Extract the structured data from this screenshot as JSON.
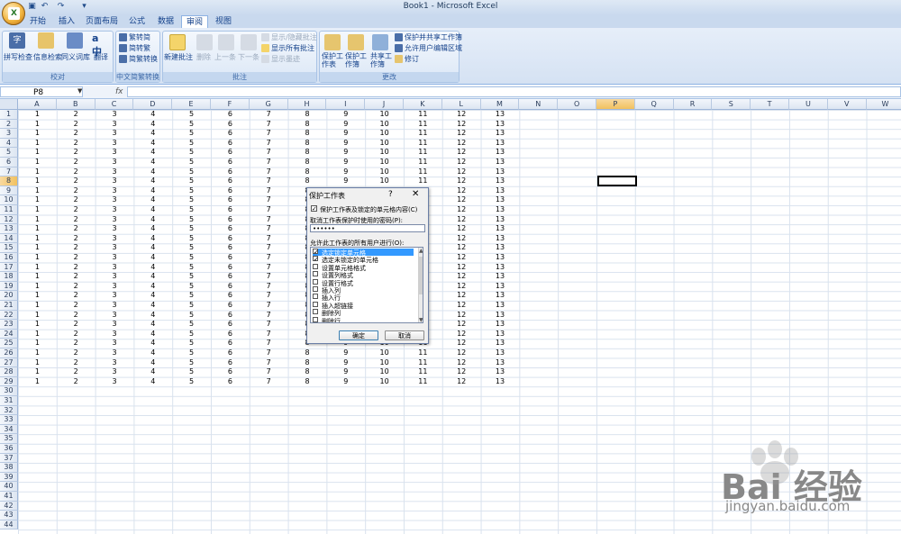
{
  "window": {
    "title": "Book1 - Microsoft Excel"
  },
  "tabs": [
    "开始",
    "插入",
    "页面布局",
    "公式",
    "数据",
    "审阅",
    "视图"
  ],
  "active_tab": "审阅",
  "ribbon": {
    "groups": [
      {
        "name": "校对",
        "buttons": [
          "拼写检查",
          "信息检索",
          "同义词库",
          "翻译"
        ]
      },
      {
        "name": "中文简繁转换",
        "buttons": [
          "繁转简",
          "简转繁",
          "简繁转换"
        ]
      },
      {
        "name": "批注",
        "buttons": [
          "新建批注",
          "删除",
          "上一条",
          "下一条"
        ],
        "small": [
          "显示/隐藏批注",
          "显示所有批注",
          "显示墨迹"
        ]
      },
      {
        "name": "更改",
        "buttons": [
          "保护工作表",
          "保护工作簿",
          "共享工作簿"
        ],
        "small": [
          "保护并共享工作簿",
          "允许用户编辑区域",
          "修订"
        ]
      }
    ]
  },
  "formula_bar": {
    "name_box": "P8",
    "fx": "fx",
    "value": ""
  },
  "grid": {
    "columns": [
      "A",
      "B",
      "C",
      "D",
      "E",
      "F",
      "G",
      "H",
      "I",
      "J",
      "K",
      "L",
      "M",
      "N",
      "O",
      "P",
      "Q",
      "R",
      "S",
      "T",
      "U",
      "V",
      "W"
    ],
    "selected_column": "P",
    "selected_row": 8,
    "row_values": [
      1,
      2,
      3,
      4,
      5,
      6,
      7,
      8,
      9,
      10,
      11,
      12,
      13
    ],
    "filled_rows": 29,
    "total_rows": 44
  },
  "dialog": {
    "title": "保护工作表",
    "help": "?",
    "close": "✕",
    "protect_label": "保护工作表及锁定的单元格内容(C)",
    "protect_checked": true,
    "password_label": "取消工作表保护时使用的密码(P):",
    "password_value": "••••••",
    "allow_label": "允许此工作表的所有用户进行(O):",
    "options": [
      {
        "label": "选定锁定单元格",
        "checked": true,
        "highlight": true
      },
      {
        "label": "选定未锁定的单元格",
        "checked": true,
        "highlight": false
      },
      {
        "label": "设置单元格格式",
        "checked": false,
        "highlight": false
      },
      {
        "label": "设置列格式",
        "checked": false,
        "highlight": false
      },
      {
        "label": "设置行格式",
        "checked": false,
        "highlight": false
      },
      {
        "label": "插入列",
        "checked": false,
        "highlight": false
      },
      {
        "label": "插入行",
        "checked": false,
        "highlight": false
      },
      {
        "label": "插入超链接",
        "checked": false,
        "highlight": false
      },
      {
        "label": "删除列",
        "checked": false,
        "highlight": false
      },
      {
        "label": "删除行",
        "checked": false,
        "highlight": false
      }
    ],
    "ok": "确定",
    "cancel": "取消"
  },
  "watermark": {
    "text": "Bai 经验",
    "url": "jingyan.baidu.com"
  },
  "colors": {
    "accent": "#15428b",
    "ribbon": "#dbe7f6",
    "selection": "#3399ff"
  }
}
